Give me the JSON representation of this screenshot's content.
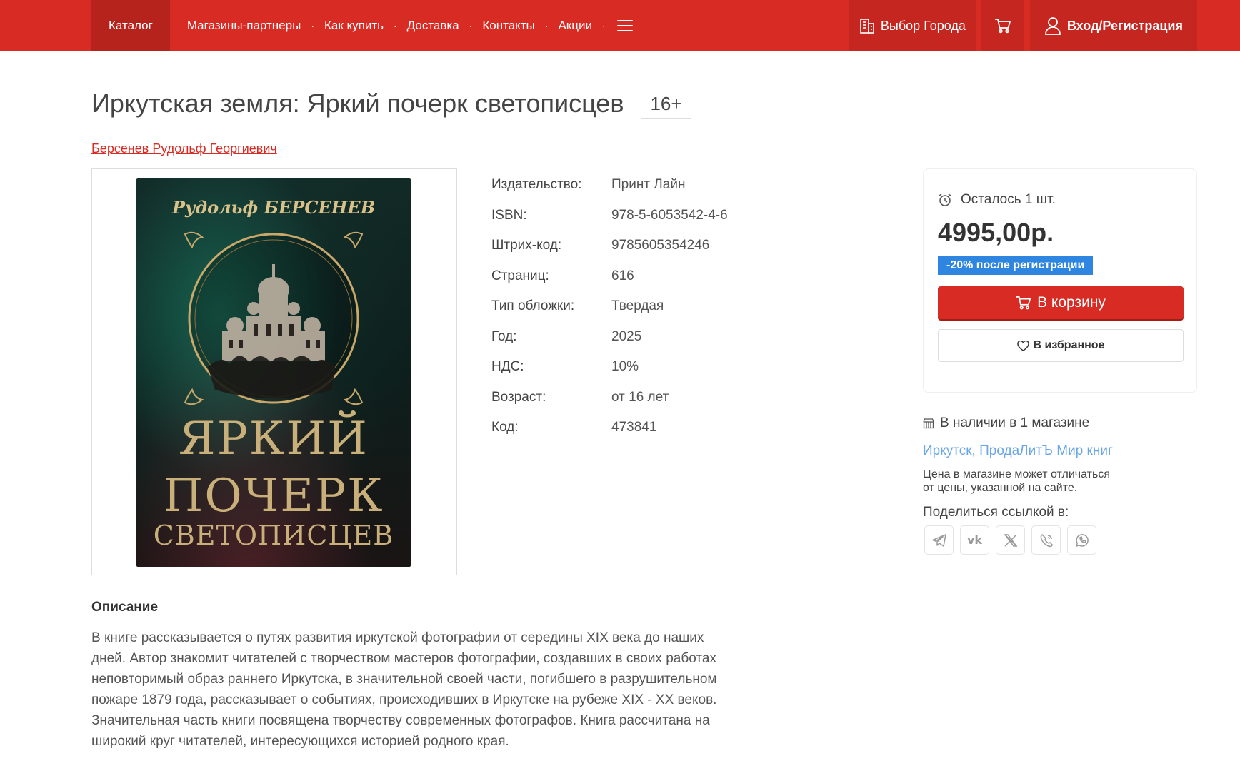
{
  "header": {
    "nav": {
      "catalog": "Каталог",
      "partners": "Магазины-партнеры",
      "how_to_buy": "Как купить",
      "delivery": "Доставка",
      "contacts": "Контакты",
      "promotions": "Акции"
    },
    "city_label": "Выбор Города",
    "login_label": "Вход/Регистрация"
  },
  "product": {
    "title": "Иркутская земля: Яркий почерк светописцев",
    "age_badge": "16+",
    "author": "Берсенев Рудольф Георгиевич",
    "cover": {
      "author_text": "Рудольф БЕРСЕНЕВ",
      "title_line1": "ЯРКИЙ",
      "title_line2": "ПОЧЕРК",
      "title_line3": "СВЕТОПИСЦЕВ"
    },
    "specs": [
      {
        "label": "Издательство:",
        "value": "Принт Лайн"
      },
      {
        "label": "ISBN:",
        "value": "978-5-6053542-4-6"
      },
      {
        "label": "Штрих-код:",
        "value": "9785605354246"
      },
      {
        "label": "Страниц:",
        "value": "616"
      },
      {
        "label": "Тип обложки:",
        "value": "Твердая"
      },
      {
        "label": "Год:",
        "value": "2025"
      },
      {
        "label": "НДС:",
        "value": "10%"
      },
      {
        "label": "Возраст:",
        "value": "от 16 лет"
      },
      {
        "label": "Код:",
        "value": "473841"
      }
    ]
  },
  "buy_box": {
    "stock": "Осталось 1 шт.",
    "price": "4995,00р.",
    "discount": "-20% после регистрации",
    "add_to_cart": "В корзину",
    "add_to_favorites": "В избранное"
  },
  "availability": {
    "in_stock": "В наличии в 1 магазине",
    "store": "Иркутск, ПродаЛитЪ Мир книг",
    "price_note_line1": "Цена в магазине может отличаться",
    "price_note_line2": "от цены, указанной на сайте.",
    "share_label": "Поделиться ссылкой в:"
  },
  "description": {
    "title": "Описание",
    "text": "В книге рассказывается о путях развития иркутской фотографии от середины XIX века до наших дней. Автор знакомит читателей с творчеством мастеров фотографии, создавших в своих работах неповторимый образ раннего Иркутска, в значительной своей части, погибшего в разрушительном пожаре 1879 года, рассказывает о событиях, происходивших в Иркутске на рубеже XIX - XX веков. Значительная часть книги посвящена творчеству современных фотографов. Книга рассчитана на широкий круг читателей, интересующихся историей родного края."
  },
  "icons": {
    "city": "building-icon",
    "cart": "cart-icon",
    "user": "user-icon",
    "stock": "alarm-clock-icon",
    "store": "store-icon",
    "favorites": "heart-icon",
    "share": [
      "telegram-icon",
      "vk-icon",
      "x-icon",
      "viber-icon",
      "whatsapp-icon"
    ]
  },
  "colors": {
    "brand_red": "#d72b23",
    "discount_blue": "#2f86e0",
    "link_blue": "#6aa6e8"
  }
}
